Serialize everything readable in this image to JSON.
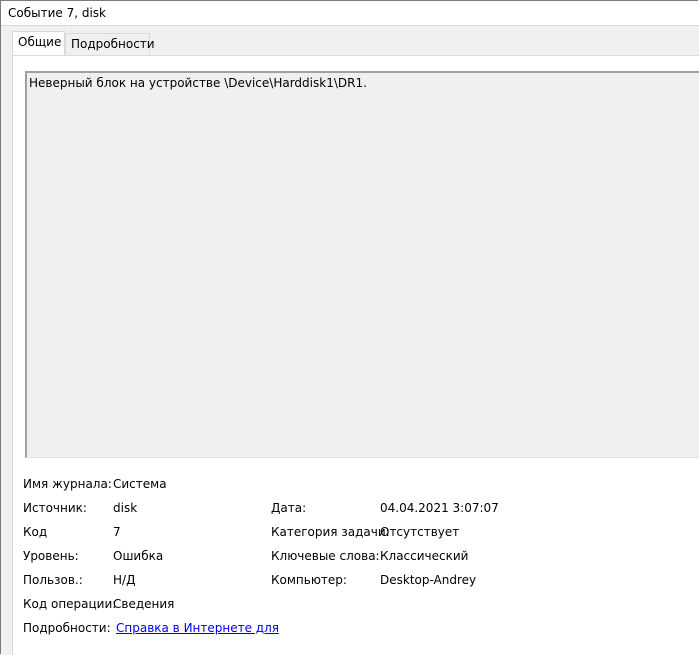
{
  "window": {
    "title": "Событие 7, disk"
  },
  "tabs": [
    {
      "label": "Общие",
      "active": true
    },
    {
      "label": "Подробности",
      "active": false
    }
  ],
  "message": "Неверный блок на устройстве \\Device\\Harddisk1\\DR1.",
  "details": {
    "log_name": {
      "label": "Имя журнала:",
      "value": "Система"
    },
    "source": {
      "label": "Источник:",
      "value": "disk"
    },
    "date": {
      "label": "Дата:",
      "value": "04.04.2021 3:07:07"
    },
    "event_id": {
      "label": "Код",
      "value": "7"
    },
    "task_category": {
      "label": "Категория задачи:",
      "value": "Отсутствует"
    },
    "level": {
      "label": "Уровень:",
      "value": "Ошибка"
    },
    "keywords": {
      "label": "Ключевые слова:",
      "value": "Классический"
    },
    "user": {
      "label": "Пользов.:",
      "value": "Н/Д"
    },
    "computer": {
      "label": "Компьютер:",
      "value": "Desktop-Andrey"
    },
    "opcode": {
      "label": "Код операции:",
      "value": "Сведения"
    },
    "more_info": {
      "label": "Подробности:",
      "link": "Справка в Интернете для "
    }
  },
  "colors": {
    "link": "#0000ee",
    "background": "#f0f0f0",
    "panel": "#ffffff"
  }
}
